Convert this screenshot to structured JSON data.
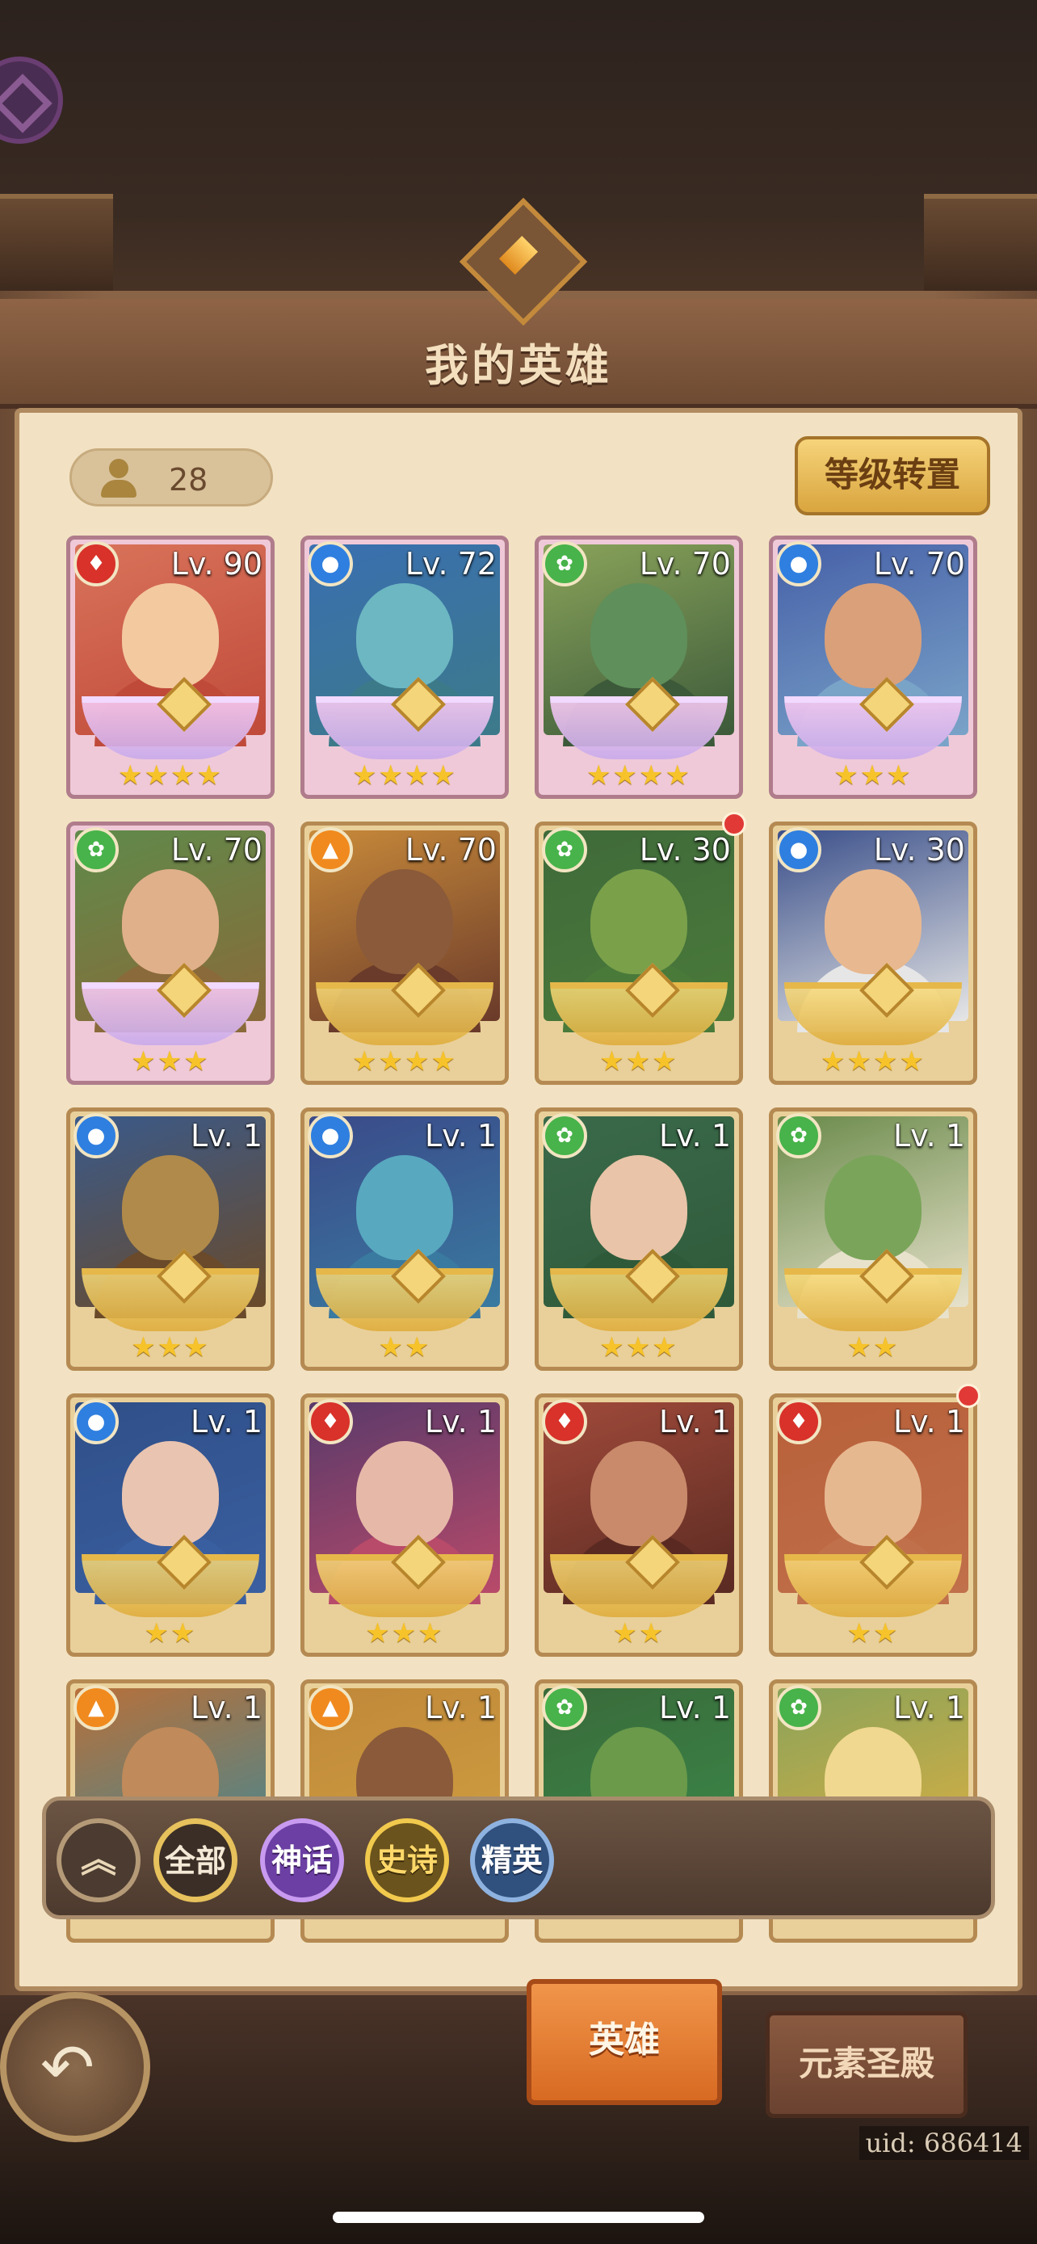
{
  "title": "我的英雄",
  "hero_count": "28",
  "level_transfer_label": "等级转置",
  "filters": {
    "collapse_icon": "double-chevron-up-icon",
    "all": "全部",
    "mythic": "神话",
    "epic": "史诗",
    "elite": "精英"
  },
  "heroes": [
    {
      "level": "Lv. 90",
      "element": "fire",
      "stars": "★★★★",
      "rarity": "legend"
    },
    {
      "level": "Lv. 72",
      "element": "water",
      "stars": "★★★★",
      "rarity": "legend"
    },
    {
      "level": "Lv. 70",
      "element": "wind",
      "stars": "★★★★",
      "rarity": "legend"
    },
    {
      "level": "Lv. 70",
      "element": "water",
      "stars": "★★★",
      "rarity": "legend"
    },
    {
      "level": "Lv. 70",
      "element": "wind",
      "stars": "★★★",
      "rarity": "legend"
    },
    {
      "level": "Lv. 70",
      "element": "light",
      "stars": "★★★★",
      "rarity": "gold"
    },
    {
      "level": "Lv. 30",
      "element": "wind",
      "stars": "★★★",
      "rarity": "gold",
      "notification": true
    },
    {
      "level": "Lv. 30",
      "element": "water",
      "stars": "★★★★",
      "rarity": "gold"
    },
    {
      "level": "Lv. 1",
      "element": "water",
      "stars": "★★★",
      "rarity": "gold"
    },
    {
      "level": "Lv. 1",
      "element": "water",
      "stars": "★★",
      "rarity": "gold"
    },
    {
      "level": "Lv. 1",
      "element": "wind",
      "stars": "★★★",
      "rarity": "gold"
    },
    {
      "level": "Lv. 1",
      "element": "wind",
      "stars": "★★",
      "rarity": "gold"
    },
    {
      "level": "Lv. 1",
      "element": "water",
      "stars": "★★",
      "rarity": "gold"
    },
    {
      "level": "Lv. 1",
      "element": "fire",
      "stars": "★★★",
      "rarity": "gold"
    },
    {
      "level": "Lv. 1",
      "element": "fire",
      "stars": "★★",
      "rarity": "gold"
    },
    {
      "level": "Lv. 1",
      "element": "fire",
      "stars": "★★",
      "rarity": "gold",
      "notification": true
    },
    {
      "level": "Lv. 1",
      "element": "light",
      "stars": "",
      "rarity": "gold"
    },
    {
      "level": "Lv. 1",
      "element": "light",
      "stars": "",
      "rarity": "gold"
    },
    {
      "level": "Lv. 1",
      "element": "wind",
      "stars": "",
      "rarity": "gold"
    },
    {
      "level": "Lv. 1",
      "element": "wind",
      "stars": "",
      "rarity": "gold"
    }
  ],
  "tabs": {
    "heroes": "英雄",
    "element_sanctum": "元素圣殿"
  },
  "uid": "uid: 686414",
  "colors": {
    "fire": "#d8322a",
    "water": "#2f7fe0",
    "wind": "#47b34a",
    "light": "#f08a1e"
  }
}
